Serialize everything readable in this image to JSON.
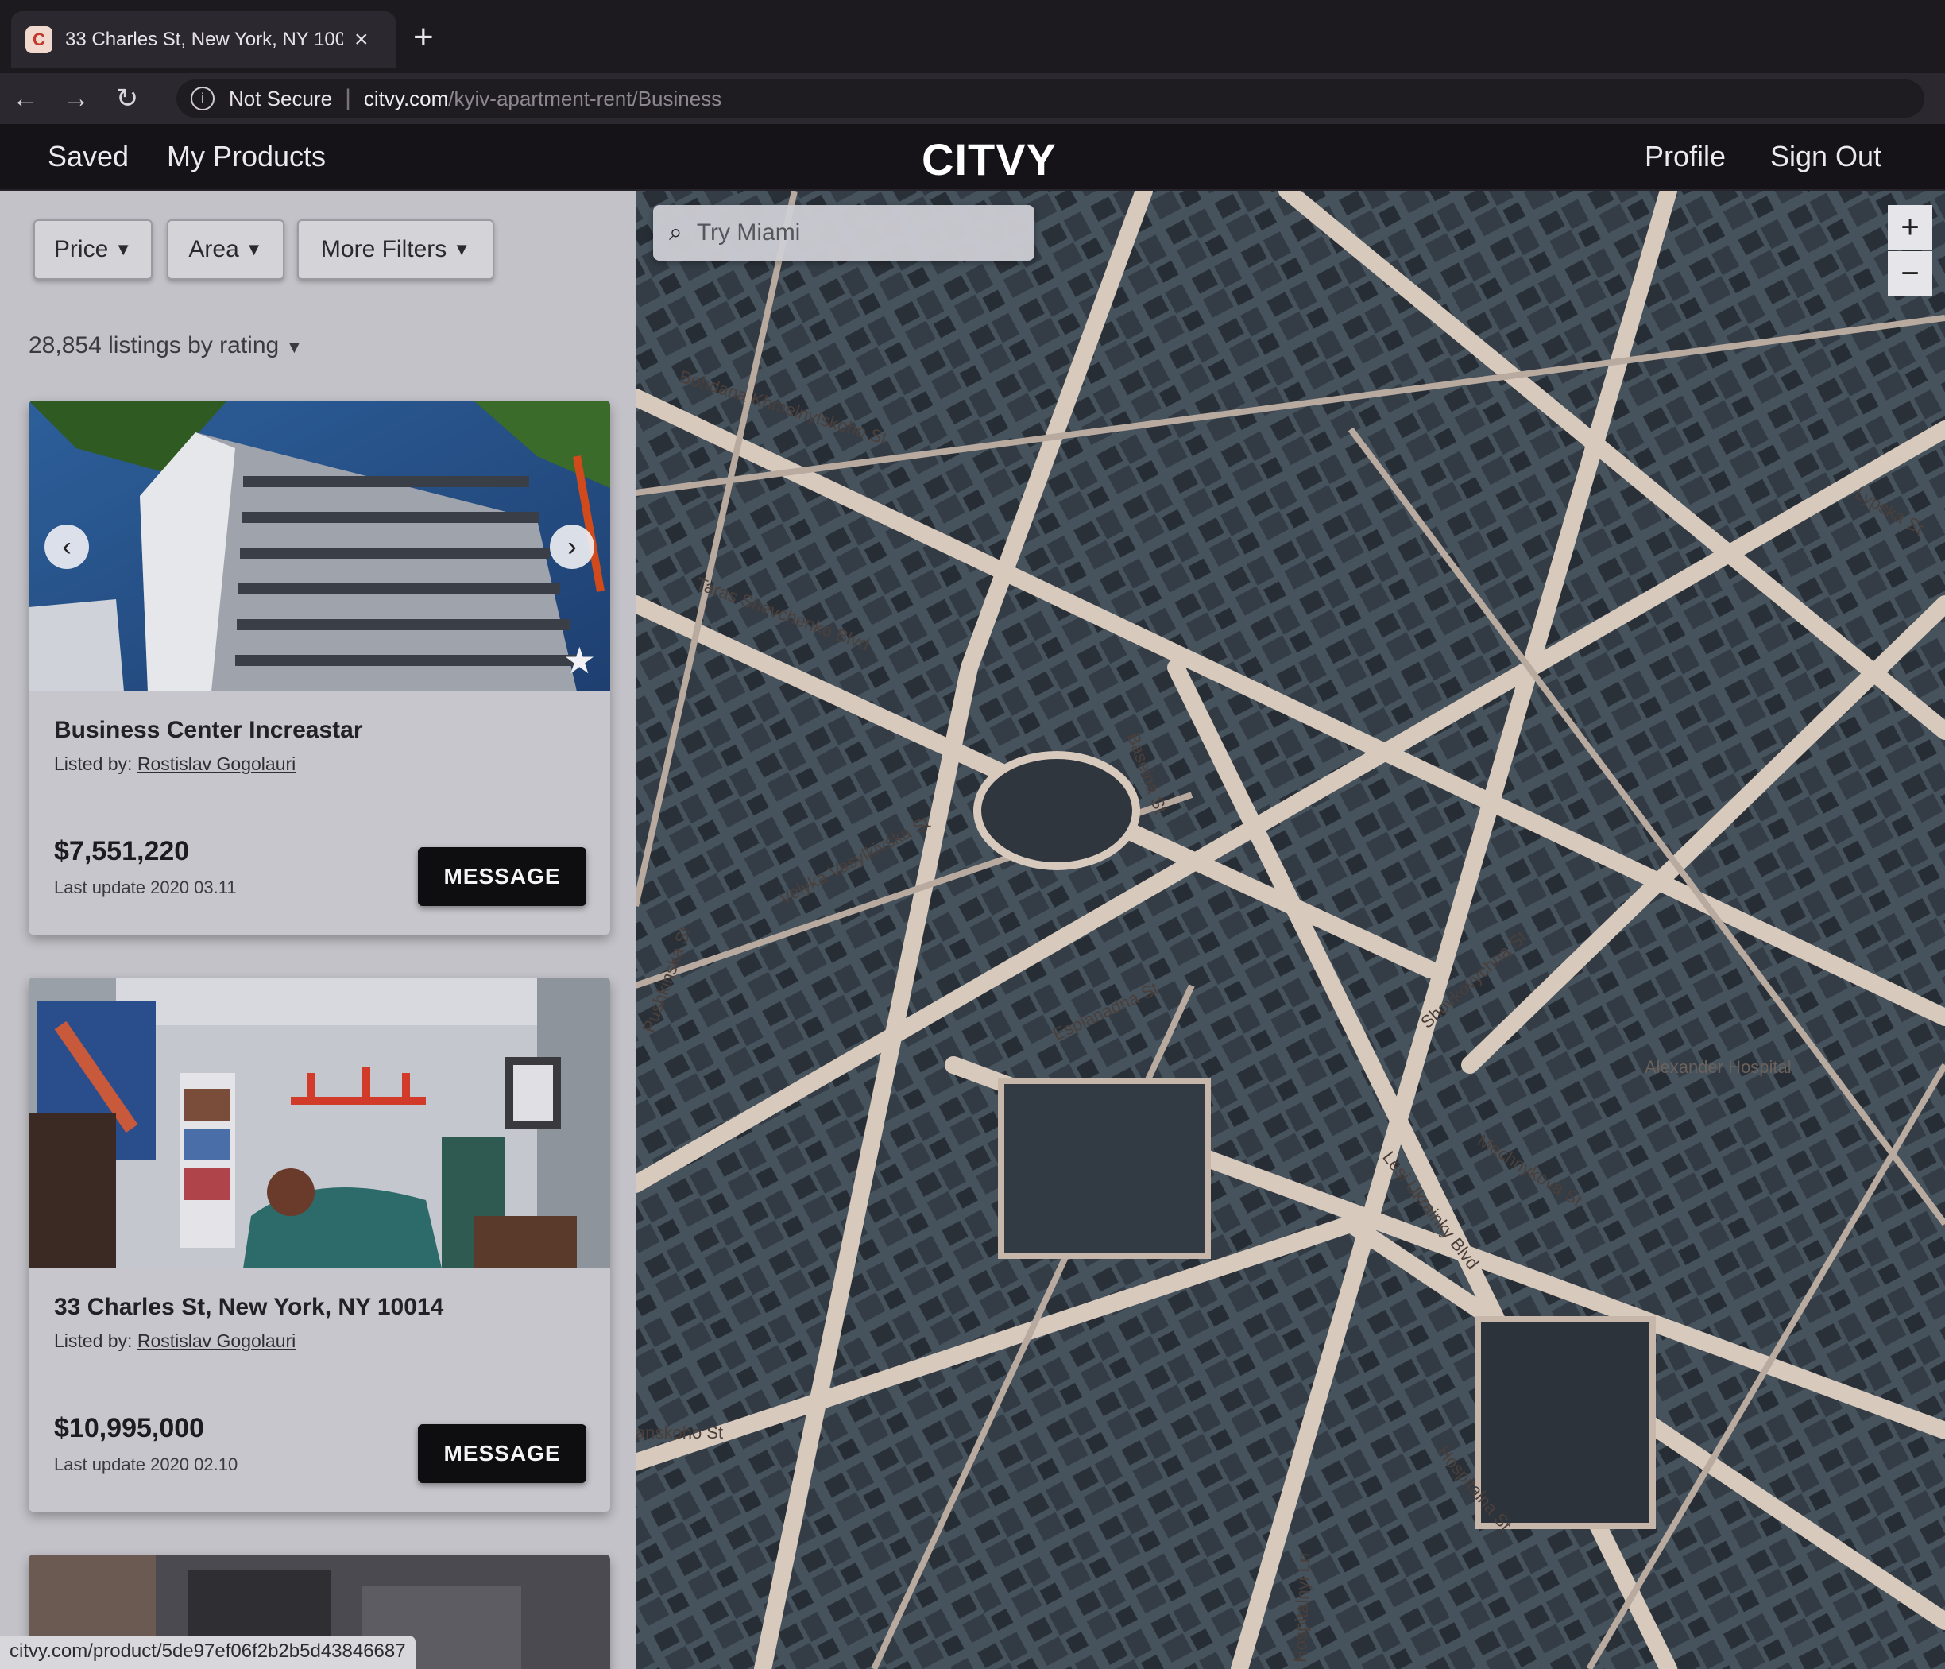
{
  "browser": {
    "tab_title": "33 Charles St, New York, NY 100",
    "tab_close": "×",
    "new_tab": "+",
    "security": "Not Secure",
    "separator": "|",
    "url_host": "citvy.com",
    "url_path": "/kyiv-apartment-rent/Business",
    "status_url": "citvy.com/product/5de97ef06f2b2b5d43846687",
    "icons": [
      "back-icon",
      "forward-icon",
      "reload-icon",
      "info-icon"
    ]
  },
  "header": {
    "saved": "Saved",
    "my_products": "My Products",
    "logo": "CITVY",
    "profile": "Profile",
    "sign_out": "Sign Out"
  },
  "filters": {
    "price": "Price",
    "area": "Area",
    "more": "More Filters"
  },
  "listing_count": "28,854 listings by rating",
  "listings": [
    {
      "title": "Business Center Increastar",
      "listed_by_label": "Listed by:",
      "owner": "Rostislav Gogolauri",
      "price": "$7,551,220",
      "updated": "Last update 2020 03.11",
      "button": "MESSAGE"
    },
    {
      "title": "33 Charles St, New York, NY 10014",
      "listed_by_label": "Listed by:",
      "owner": "Rostislav Gogolauri",
      "price": "$10,995,000",
      "updated": "Last update 2020 02.10",
      "button": "MESSAGE"
    }
  ],
  "map": {
    "search_placeholder": "Try Miami",
    "zoom_in": "+",
    "zoom_out": "−",
    "labels": {
      "s1": "Bohdana Khmelnytskoho St",
      "s2": "Taras Shevchenko Blvd",
      "s3": "Velyka Vasylkivska St",
      "s4": "Baseina St",
      "s5": "Esplanadna St",
      "s6": "Lesi Ukrainky Blvd",
      "s7": "Mechnykova St",
      "s8": "Shovkovychna St",
      "s9": "Hospitalna St",
      "s10": "Alexander Hospital",
      "s11": "Pushkinska St",
      "s12": "Lypska St",
      "s13": "anskoho St",
      "s14": "Hospitalnyi Ln"
    }
  },
  "colors": {
    "chrome_bg": "#1c1a1f",
    "header_bg": "#151318",
    "panel_bg": "#c2c2c8",
    "button_dark": "#0e0d10",
    "map_base": "#3f4953"
  }
}
